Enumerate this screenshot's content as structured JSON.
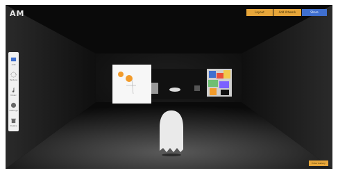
{
  "header": {
    "logo": "AM"
  },
  "toolbar": {
    "buttons": [
      {
        "label": "Layout"
      },
      {
        "label": "Add Artwork"
      },
      {
        "label": "Share"
      }
    ]
  },
  "sidebar": {
    "tools": [
      {
        "icon": "frame-icon",
        "label": "Add"
      },
      {
        "icon": "texture-icon",
        "label": "Texture"
      },
      {
        "icon": "music-icon",
        "label": "Music"
      },
      {
        "icon": "globe-icon",
        "label": "Settings"
      },
      {
        "icon": "trash-icon",
        "label": "Delete"
      }
    ]
  },
  "footer": {
    "button_label": "Enter Gallery"
  },
  "colors": {
    "accent": "#e7a63a",
    "primary": "#3f6fcf",
    "background": "#0d0d0d"
  }
}
